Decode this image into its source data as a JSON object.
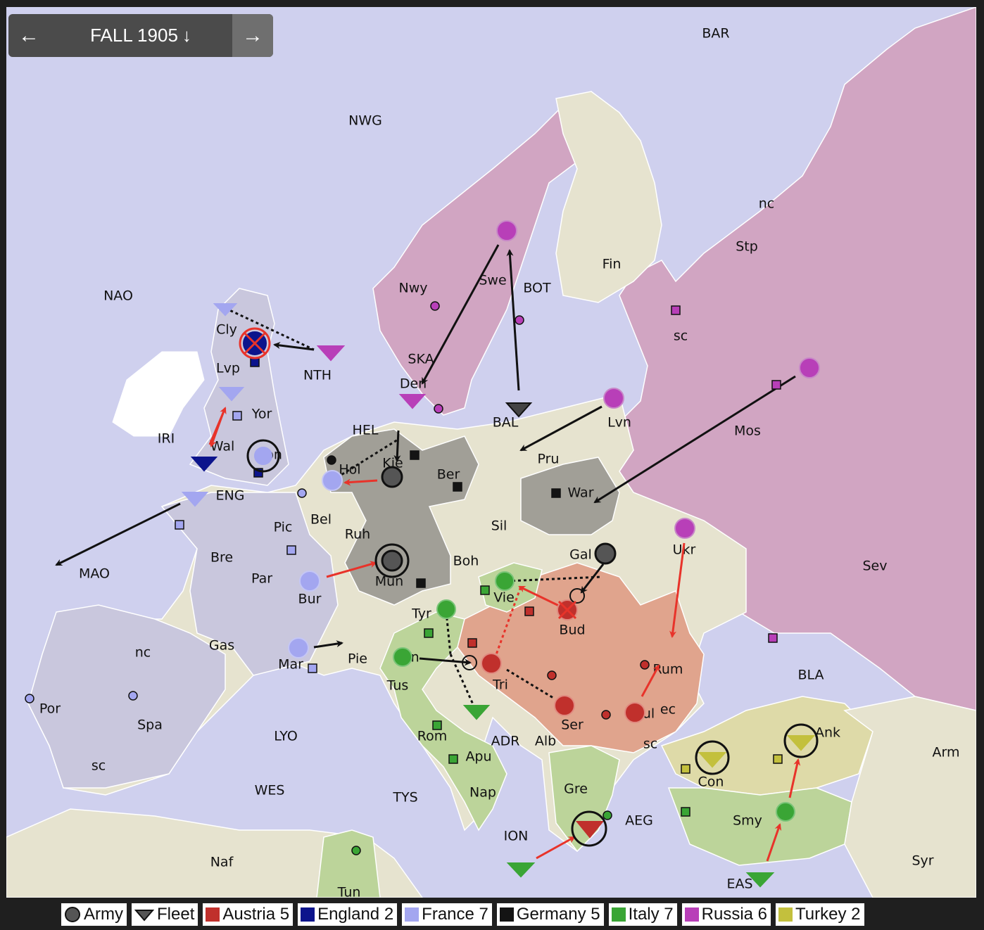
{
  "navigation": {
    "prev_icon": "←",
    "title": "FALL 1905",
    "title_icon": "↓",
    "next_icon": "→"
  },
  "colors": {
    "sea": "#cfd0ee",
    "neutral": "#e6e3cf",
    "austria": "#e0a48d",
    "england": "#8d8ec0",
    "france": "#c9c7dd",
    "germany": "#a19f97",
    "italy": "#bcd49a",
    "russia": "#d1a5c2",
    "turkey": "#dedaa8",
    "austria_unit": "#c0302c",
    "england_unit": "#0c148c",
    "france_unit": "#a3a6f0",
    "germany_unit": "#141414",
    "italy_unit": "#3aa535",
    "russia_unit": "#b83fb8",
    "turkey_unit": "#c3c03d"
  },
  "labels": [
    {
      "text": "BAR"
    },
    {
      "text": "NWG"
    },
    {
      "text": "nc"
    },
    {
      "text": "Stp"
    },
    {
      "text": "Fin"
    },
    {
      "text": "NAO"
    },
    {
      "text": "Nwy"
    },
    {
      "text": "Swe"
    },
    {
      "text": "BOT"
    },
    {
      "text": "sc"
    },
    {
      "text": "Cly"
    },
    {
      "text": "NTH"
    },
    {
      "text": "Lvp"
    },
    {
      "text": "SKA"
    },
    {
      "text": "Den"
    },
    {
      "text": "Yor"
    },
    {
      "text": "HEL"
    },
    {
      "text": "BAL"
    },
    {
      "text": "Lvn"
    },
    {
      "text": "Mos"
    },
    {
      "text": "IRI"
    },
    {
      "text": "Wal"
    },
    {
      "text": "Lon"
    },
    {
      "text": "Kie"
    },
    {
      "text": "Hol"
    },
    {
      "text": "Pru"
    },
    {
      "text": "Ber"
    },
    {
      "text": "War"
    },
    {
      "text": "ENG"
    },
    {
      "text": "Bel"
    },
    {
      "text": "Pic"
    },
    {
      "text": "Sil"
    },
    {
      "text": "Ruh"
    },
    {
      "text": "Ukr"
    },
    {
      "text": "Gal"
    },
    {
      "text": "Bre"
    },
    {
      "text": "MAO"
    },
    {
      "text": "Boh"
    },
    {
      "text": "Sev"
    },
    {
      "text": "Par"
    },
    {
      "text": "Bur"
    },
    {
      "text": "Mun"
    },
    {
      "text": "Vie"
    },
    {
      "text": "Tyr"
    },
    {
      "text": "Bud"
    },
    {
      "text": "Gas"
    },
    {
      "text": "nc"
    },
    {
      "text": "Rum"
    },
    {
      "text": "Mar"
    },
    {
      "text": "Pie"
    },
    {
      "text": "Ven"
    },
    {
      "text": "BLA"
    },
    {
      "text": "Tri"
    },
    {
      "text": "Por"
    },
    {
      "text": "Tus"
    },
    {
      "text": "Ser"
    },
    {
      "text": "Spa"
    },
    {
      "text": "Bul"
    },
    {
      "text": "ec"
    },
    {
      "text": "LYO"
    },
    {
      "text": "Rom"
    },
    {
      "text": "ADR"
    },
    {
      "text": "Alb"
    },
    {
      "text": "sc"
    },
    {
      "text": "Ank"
    },
    {
      "text": "Arm"
    },
    {
      "text": "Apu"
    },
    {
      "text": "sc"
    },
    {
      "text": "Con"
    },
    {
      "text": "WES"
    },
    {
      "text": "TYS"
    },
    {
      "text": "Nap"
    },
    {
      "text": "Gre"
    },
    {
      "text": "AEG"
    },
    {
      "text": "Smy"
    },
    {
      "text": "ION"
    },
    {
      "text": "Naf"
    },
    {
      "text": "Syr"
    },
    {
      "text": "EAS"
    },
    {
      "text": "Tun"
    }
  ],
  "legend": [
    {
      "label": "Army",
      "icon": "army-icon"
    },
    {
      "label": "Fleet",
      "icon": "fleet-icon"
    },
    {
      "label": "Austria 5",
      "color": "#c0302c"
    },
    {
      "label": "England 2",
      "color": "#0c148c"
    },
    {
      "label": "France 7",
      "color": "#a3a6f0"
    },
    {
      "label": "Germany 5",
      "color": "#141414"
    },
    {
      "label": "Italy 7",
      "color": "#3aa535"
    },
    {
      "label": "Russia 6",
      "color": "#b83fb8"
    },
    {
      "label": "Turkey 2",
      "color": "#c3c03d"
    }
  ]
}
